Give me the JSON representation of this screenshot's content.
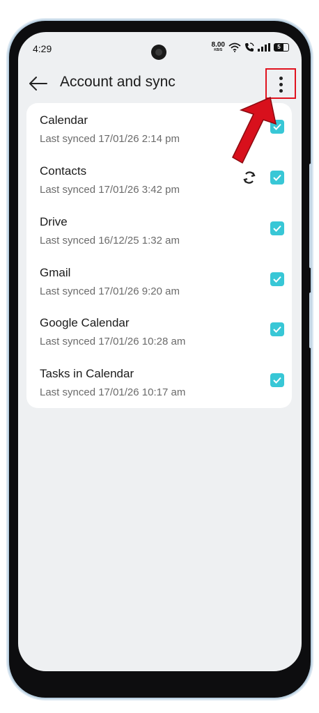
{
  "status_bar": {
    "time": "4:29",
    "net_speed_value": "8.00",
    "net_speed_unit": "KB/S",
    "battery_level": "5",
    "icons": [
      "wifi-icon",
      "call-icon",
      "signal-icon",
      "battery-icon"
    ]
  },
  "header": {
    "title": "Account and sync",
    "back_icon": "back-arrow-icon",
    "menu_icon": "more-vertical-icon"
  },
  "sync_items": [
    {
      "title": "Calendar",
      "subtitle": "Last synced 17/01/26 2:14 pm",
      "checked": true
    },
    {
      "title": "Contacts",
      "subtitle": "Last synced 17/01/26 3:42 pm",
      "checked": true,
      "syncing": true
    },
    {
      "title": "Drive",
      "subtitle": "Last synced 16/12/25 1:32 am",
      "checked": true
    },
    {
      "title": "Gmail",
      "subtitle": "Last synced 17/01/26 9:20 am",
      "checked": true
    },
    {
      "title": "Google Calendar",
      "subtitle": "Last synced 17/01/26 10:28 am",
      "checked": true
    },
    {
      "title": "Tasks in Calendar",
      "subtitle": "Last synced 17/01/26 10:17 am",
      "checked": true
    }
  ],
  "colors": {
    "accent": "#38c7d6",
    "annotation": "#e0121e",
    "background": "#eef0f2",
    "card": "#ffffff"
  }
}
